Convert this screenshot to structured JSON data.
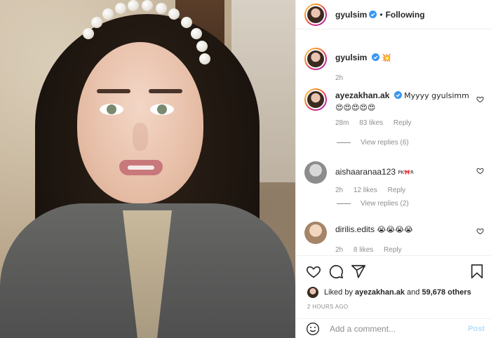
{
  "header": {
    "username": "gyulsim",
    "separator": "•",
    "follow_status": "Following"
  },
  "caption": {
    "username": "gyulsim",
    "text": "💥",
    "time": "2h"
  },
  "comments": [
    {
      "username": "ayezakhan.ak",
      "verified": true,
      "text": "Myyyy gyulsimm 😍😍😍😍😍",
      "time": "28m",
      "likes": "83 likes",
      "reply_label": "Reply",
      "view_replies": "View replies (6)"
    },
    {
      "username": "aishaaranaa123",
      "verified": false,
      "text": "",
      "badge": "PK🎀R",
      "time": "2h",
      "likes": "12 likes",
      "reply_label": "Reply",
      "view_replies": "View replies (2)"
    },
    {
      "username": "dirilis.edits",
      "verified": false,
      "text": "😭😭😭😭",
      "time": "2h",
      "likes": "8 likes",
      "reply_label": "Reply"
    }
  ],
  "likes_summary": {
    "prefix": "Liked by",
    "user": "ayezakhan.ak",
    "middle": "and",
    "count": "59,678 others"
  },
  "timestamp": "2 HOURS AGO",
  "add_comment": {
    "placeholder": "Add a comment...",
    "post_label": "Post"
  },
  "icons": {
    "like": "heart-icon",
    "comment": "comment-icon",
    "share": "paper-plane-icon",
    "save": "bookmark-icon",
    "emoji": "smiley-icon",
    "verified": "verified-badge-icon"
  },
  "colors": {
    "verified_blue": "#3897f0",
    "muted_text": "#8e8e8e",
    "post_disabled": "#b2dffc"
  }
}
